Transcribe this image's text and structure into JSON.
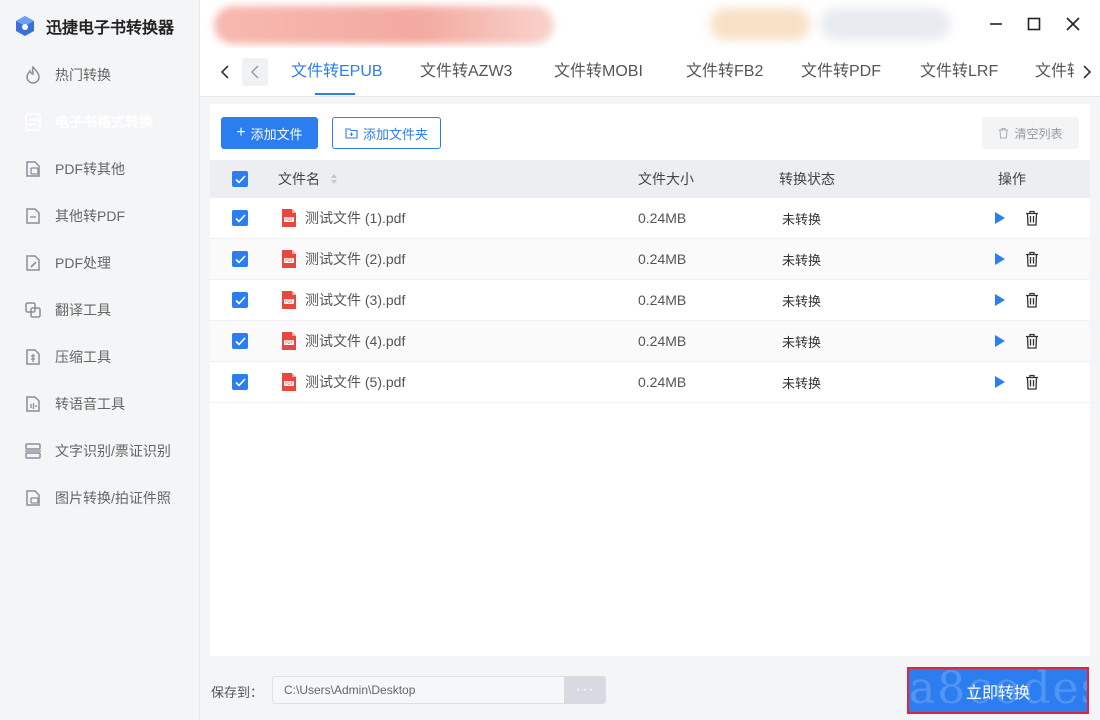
{
  "app": {
    "title": "迅捷电子书转换器"
  },
  "sidebar": {
    "items": [
      {
        "label": "热门转换",
        "icon": "fire-icon",
        "active": false
      },
      {
        "label": "电子书格式转换",
        "icon": "ebook-convert-icon",
        "active": true
      },
      {
        "label": "PDF转其他",
        "icon": "pdf-to-other-icon",
        "active": false
      },
      {
        "label": "其他转PDF",
        "icon": "other-to-pdf-icon",
        "active": false
      },
      {
        "label": "PDF处理",
        "icon": "pdf-edit-icon",
        "active": false
      },
      {
        "label": "翻译工具",
        "icon": "translate-icon",
        "active": false
      },
      {
        "label": "压缩工具",
        "icon": "compress-icon",
        "active": false
      },
      {
        "label": "转语音工具",
        "icon": "voice-icon",
        "active": false
      },
      {
        "label": "文字识别/票证识别",
        "icon": "ocr-icon",
        "active": false
      },
      {
        "label": "图片转换/拍证件照",
        "icon": "image-convert-icon",
        "active": false
      }
    ]
  },
  "tabs": [
    {
      "label": "文件转EPUB",
      "active": true
    },
    {
      "label": "文件转AZW3",
      "active": false
    },
    {
      "label": "文件转MOBI",
      "active": false
    },
    {
      "label": "文件转FB2",
      "active": false
    },
    {
      "label": "文件转PDF",
      "active": false
    },
    {
      "label": "文件转LRF",
      "active": false
    },
    {
      "label": "文件转",
      "active": false
    }
  ],
  "toolbar": {
    "add_file": "添加文件",
    "add_folder": "添加文件夹",
    "clear_list": "清空列表"
  },
  "table": {
    "headers": {
      "name": "文件名",
      "size": "文件大小",
      "status": "转换状态",
      "action": "操作"
    },
    "rows": [
      {
        "name": "测试文件 (1).pdf",
        "size": "0.24MB",
        "status": "未转换"
      },
      {
        "name": "测试文件 (2).pdf",
        "size": "0.24MB",
        "status": "未转换"
      },
      {
        "name": "测试文件 (3).pdf",
        "size": "0.24MB",
        "status": "未转换"
      },
      {
        "name": "测试文件 (4).pdf",
        "size": "0.24MB",
        "status": "未转换"
      },
      {
        "name": "测试文件 (5).pdf",
        "size": "0.24MB",
        "status": "未转换"
      }
    ]
  },
  "footer": {
    "save_label": "保存到：",
    "save_path": "C:\\Users\\Admin\\Desktop",
    "browse_label": "···",
    "convert_label": "立即转换",
    "watermark": "a8codes"
  },
  "colors": {
    "accent": "#2b7df0",
    "pdf_red": "#e5483f",
    "highlight_border": "#e0243a"
  }
}
